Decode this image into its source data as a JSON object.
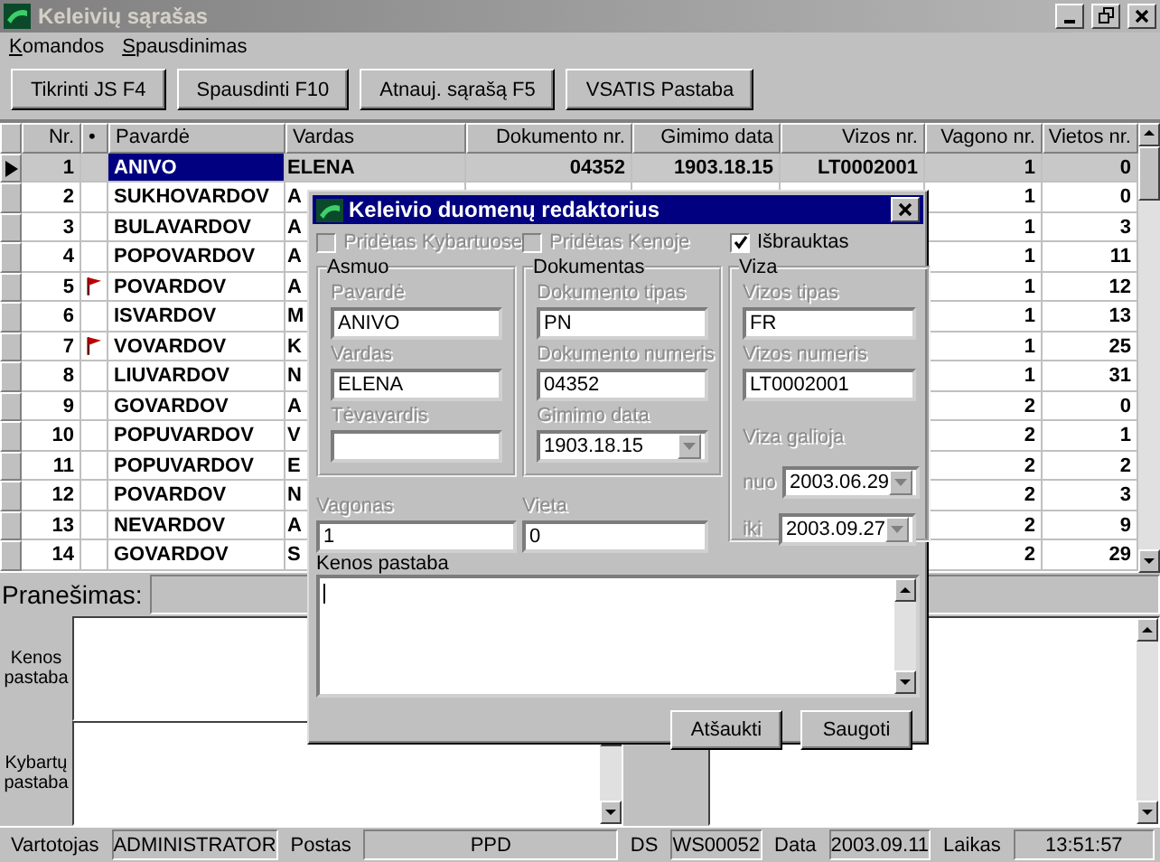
{
  "window": {
    "title": "Keleivių sąrašas"
  },
  "menu": [
    "Komandos",
    "Spausdinimas"
  ],
  "toolbar": [
    "Tikrinti JS F4",
    "Spausdinti  F10",
    "Atnauj. sąrašą  F5",
    "VSATIS Pastaba"
  ],
  "table": {
    "columns": [
      "Nr.",
      "•",
      "Pavardė",
      "Vardas",
      "Dokumento nr.",
      "Gimimo data",
      "Vizos nr.",
      "Vagono nr.",
      "Vietos nr."
    ],
    "rows": [
      {
        "nr": "1",
        "flagged": false,
        "selected": true,
        "surname": "ANIVO",
        "name": "ELENA",
        "document": "04352",
        "birth": "1903.18.15",
        "visa": "LT0002001",
        "wagon": "1",
        "seat": "0"
      },
      {
        "nr": "2",
        "flagged": false,
        "selected": false,
        "surname": "SUKHOVARDOV",
        "name": "A",
        "wagon": "1",
        "seat": "0"
      },
      {
        "nr": "3",
        "flagged": false,
        "selected": false,
        "surname": "BULAVARDOV",
        "name": "A",
        "wagon": "1",
        "seat": "3"
      },
      {
        "nr": "4",
        "flagged": false,
        "selected": false,
        "surname": "POPOVARDOV",
        "name": "A",
        "wagon": "1",
        "seat": "11"
      },
      {
        "nr": "5",
        "flagged": true,
        "selected": false,
        "surname": "POVARDOV",
        "name": "A",
        "wagon": "1",
        "seat": "12"
      },
      {
        "nr": "6",
        "flagged": false,
        "selected": false,
        "surname": "ISVARDOV",
        "name": "M",
        "wagon": "1",
        "seat": "13"
      },
      {
        "nr": "7",
        "flagged": true,
        "selected": false,
        "surname": "VOVARDOV",
        "name": "K",
        "wagon": "1",
        "seat": "25"
      },
      {
        "nr": "8",
        "flagged": false,
        "selected": false,
        "surname": "LIUVARDOV",
        "name": "N",
        "wagon": "1",
        "seat": "31"
      },
      {
        "nr": "9",
        "flagged": false,
        "selected": false,
        "surname": "GOVARDOV",
        "name": "A",
        "wagon": "2",
        "seat": "0"
      },
      {
        "nr": "10",
        "flagged": false,
        "selected": false,
        "surname": "POPUVARDOV",
        "name": "V",
        "wagon": "2",
        "seat": "1"
      },
      {
        "nr": "11",
        "flagged": false,
        "selected": false,
        "surname": "POPUVARDOV",
        "name": "E",
        "wagon": "2",
        "seat": "2"
      },
      {
        "nr": "12",
        "flagged": false,
        "selected": false,
        "surname": "POVARDOV",
        "name": "N",
        "wagon": "2",
        "seat": "3"
      },
      {
        "nr": "13",
        "flagged": false,
        "selected": false,
        "surname": "NEVARDOV",
        "name": "A",
        "wagon": "2",
        "seat": "9"
      },
      {
        "nr": "14",
        "flagged": false,
        "selected": false,
        "surname": "GOVARDOV",
        "name": "S",
        "wagon": "2",
        "seat": "29"
      }
    ]
  },
  "message": {
    "label": "Pranešimas:"
  },
  "notes": [
    {
      "label": "Kenos pastaba"
    },
    {
      "label": "Kybartų pastaba"
    }
  ],
  "status_bar": [
    {
      "label": "Vartotojas",
      "value": "ADMINISTRATOR"
    },
    {
      "label": "Postas",
      "value": "PPD"
    },
    {
      "label": "DS",
      "value": "WS00052"
    },
    {
      "label": "Data",
      "value": "2003.09.11"
    },
    {
      "label": "Laikas",
      "value": "13:51:57"
    }
  ],
  "dialog": {
    "title": "Keleivio duomenų redaktorius",
    "checkboxes": [
      {
        "label": "Pridėtas Kybartuose",
        "checked": false,
        "disabled": true
      },
      {
        "label": "Pridėtas Kenoje",
        "checked": false,
        "disabled": true
      },
      {
        "label": "Išbrauktas",
        "checked": true,
        "disabled": false
      }
    ],
    "groups": [
      {
        "title": "Asmuo",
        "fields": [
          {
            "label": "Pavardė",
            "value": "ANIVO",
            "kind": "text"
          },
          {
            "label": "Vardas",
            "value": "ELENA",
            "kind": "text"
          },
          {
            "label": "Tėvavardis",
            "kind": "text"
          }
        ]
      },
      {
        "title": "Dokumentas",
        "fields": [
          {
            "label": "Dokumento tipas",
            "value": "PN",
            "kind": "text"
          },
          {
            "label": "Dokumento numeris",
            "value": "04352",
            "kind": "text"
          },
          {
            "label": "Gimimo data",
            "value": "1903.18.15",
            "kind": "combo"
          }
        ]
      },
      {
        "title": "Viza",
        "fields": [
          {
            "label": "Vizos tipas",
            "value": "FR",
            "kind": "text"
          },
          {
            "label": "Vizos numeris",
            "value": "LT0002001",
            "kind": "text"
          }
        ],
        "validity": {
          "label": "Viza galioja",
          "ranges": [
            {
              "label": "nuo",
              "value": "2003.06.29"
            },
            {
              "label": "iki",
              "value": "2003.09.27"
            }
          ]
        }
      }
    ],
    "extra_fields": [
      {
        "label": "Vagonas",
        "value": "1",
        "kind": "text"
      },
      {
        "label": "Vieta",
        "value": "0",
        "kind": "text"
      }
    ],
    "note": {
      "label": "Kenos pastaba"
    },
    "buttons": [
      "Atšaukti",
      "Saugoti"
    ]
  }
}
